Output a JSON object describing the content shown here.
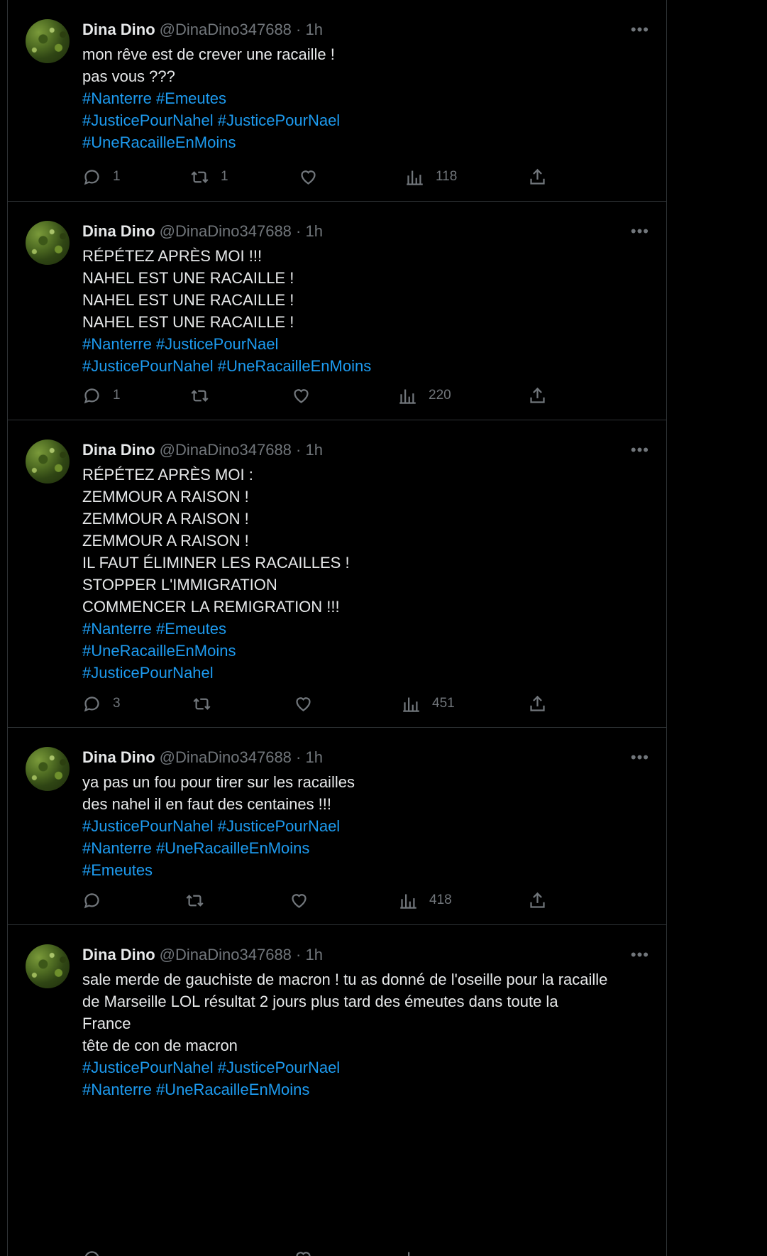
{
  "author": {
    "name": "Dina Dino",
    "handle": "@DinaDino347688",
    "time": "1h",
    "separator": "·"
  },
  "more_label": "•••",
  "tweets": [
    {
      "lines": [
        "mon rêve est de crever une racaille !",
        "pas vous ???"
      ],
      "tags": [
        "#Nanterre #Emeutes",
        "#JusticePourNahel #JusticePourNael",
        "#UneRacailleEnMoins"
      ],
      "replies": "1",
      "retweets": "1",
      "likes": "",
      "views": "118"
    },
    {
      "lines": [
        "RÉPÉTEZ APRÈS MOI !!!",
        "NAHEL EST UNE RACAILLE !",
        "NAHEL EST UNE RACAILLE !",
        "NAHEL EST UNE RACAILLE !"
      ],
      "tags": [
        "#Nanterre #JusticePourNael",
        "#JusticePourNahel #UneRacailleEnMoins"
      ],
      "replies": "1",
      "retweets": "",
      "likes": "",
      "views": "220"
    },
    {
      "lines": [
        "RÉPÉTEZ APRÈS MOI :",
        "ZEMMOUR A RAISON !",
        "ZEMMOUR A RAISON !",
        "ZEMMOUR A RAISON !",
        "IL FAUT ÉLIMINER LES RACAILLES !",
        "STOPPER L'IMMIGRATION",
        "COMMENCER LA REMIGRATION !!!"
      ],
      "tags": [
        "#Nanterre #Emeutes",
        "#UneRacailleEnMoins",
        "#JusticePourNahel"
      ],
      "replies": "3",
      "retweets": "",
      "likes": "",
      "views": "451"
    },
    {
      "lines": [
        "ya pas un fou pour tirer sur les racailles",
        "des nahel il en faut des centaines !!!"
      ],
      "tags": [
        "#JusticePourNahel #JusticePourNael",
        "#Nanterre #UneRacailleEnMoins",
        "#Emeutes"
      ],
      "replies": "",
      "retweets": "",
      "likes": "",
      "views": "418"
    },
    {
      "lines": [
        "sale merde de gauchiste de macron ! tu as donné de l'oseille pour la racaille",
        "de Marseille LOL résultat 2 jours plus tard des émeutes dans toute la",
        "France",
        "tête de con de macron"
      ],
      "tags": [
        "#JusticePourNahel #JusticePourNael",
        "#Nanterre #UneRacailleEnMoins"
      ],
      "replies": "",
      "retweets": "",
      "likes": "",
      "views": ""
    }
  ]
}
